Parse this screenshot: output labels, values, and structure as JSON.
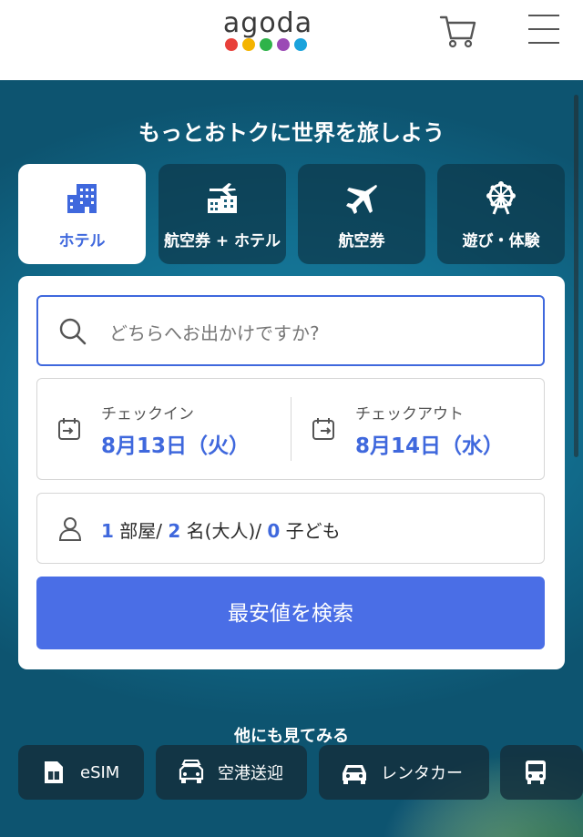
{
  "header": {
    "logo_text": "agoda",
    "logo_colors": [
      "#e8403a",
      "#f4b400",
      "#2fb34a",
      "#9b4ab5",
      "#1aa3dc"
    ],
    "cart_icon": "cart-icon",
    "menu_icon": "hamburger-icon"
  },
  "hero": {
    "tagline": "もっとおトクに世界を旅しよう",
    "tabs": [
      {
        "label": "ホテル",
        "icon": "hotel-icon",
        "active": true
      },
      {
        "label": "航空券 + ホテル",
        "icon": "flight-hotel-icon",
        "active": false
      },
      {
        "label": "航空券",
        "icon": "airplane-icon",
        "active": false
      },
      {
        "label": "遊び・体験",
        "icon": "ferris-wheel-icon",
        "active": false
      }
    ]
  },
  "search": {
    "placeholder": "どちらへお出かけですか?",
    "checkin_label": "チェックイン",
    "checkin_value": "8月13日（火）",
    "checkout_label": "チェックアウト",
    "checkout_value": "8月14日（水）",
    "occupancy": {
      "rooms": "1",
      "rooms_unit": "部屋/",
      "adults": "2",
      "adults_unit": "名(大人)/",
      "children": "0",
      "children_unit": "子ども"
    },
    "submit_label": "最安値を検索"
  },
  "more": {
    "title": "他にも見てみる",
    "chips": [
      {
        "label": "eSIM",
        "icon": "sim-card-icon"
      },
      {
        "label": "空港送迎",
        "icon": "taxi-icon"
      },
      {
        "label": "レンタカー",
        "icon": "car-icon"
      },
      {
        "label": "",
        "icon": "bus-icon"
      }
    ]
  },
  "colors": {
    "accent": "#3f68dd",
    "button": "#4a6ee6"
  }
}
